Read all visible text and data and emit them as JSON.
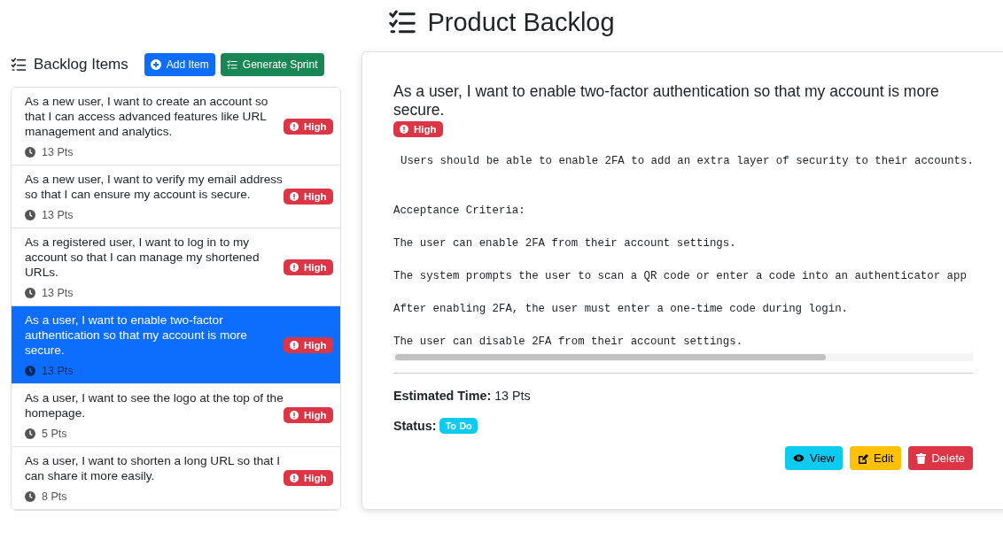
{
  "page_title": "Product Backlog",
  "backlog": {
    "heading": "Backlog Items",
    "buttons": [
      {
        "label": "Add Item",
        "kind": "add"
      },
      {
        "label": "Generate Sprint",
        "kind": "sprint"
      }
    ],
    "items": [
      {
        "title": "As a new user, I want to create an account so that I can access advanced features like URL management and analytics.",
        "priority": "High",
        "points": "13 Pts",
        "selected": false
      },
      {
        "title": "As a new user, I want to verify my email address so that I can ensure my account is secure.",
        "priority": "High",
        "points": "13 Pts",
        "selected": false
      },
      {
        "title": "As a registered user, I want to log in to my account so that I can manage my shortened URLs.",
        "priority": "High",
        "points": "13 Pts",
        "selected": false
      },
      {
        "title": "As a user, I want to enable two-factor authentication so that my account is more secure.",
        "priority": "High",
        "points": "13 Pts",
        "selected": true
      },
      {
        "title": "As a user, I want to see the logo at the top of the homepage.",
        "priority": "High",
        "points": "5 Pts",
        "selected": false
      },
      {
        "title": "As a user, I want to shorten a long URL so that I can share it more easily.",
        "priority": "High",
        "points": "8 Pts",
        "selected": false
      }
    ]
  },
  "detail": {
    "title": "As a user, I want to enable two-factor authentication so that my account is more secure.",
    "priority": "High",
    "description": "Users should be able to enable 2FA to add an extra layer of security to their accounts.",
    "criteria_heading": "Acceptance Criteria:",
    "criteria": [
      "The user can enable 2FA from their account settings.",
      "The system prompts the user to scan a QR code or enter a code into an authenticator app",
      "After enabling 2FA, the user must enter a one-time code during login.",
      "The user can disable 2FA from their account settings."
    ],
    "estimate_label": "Estimated Time:",
    "estimate": "13 Pts",
    "status_label": "Status:",
    "status": "To Do",
    "actions": [
      {
        "label": "View",
        "kind": "view"
      },
      {
        "label": "Edit",
        "kind": "edit"
      },
      {
        "label": "Delete",
        "kind": "delete"
      }
    ]
  }
}
